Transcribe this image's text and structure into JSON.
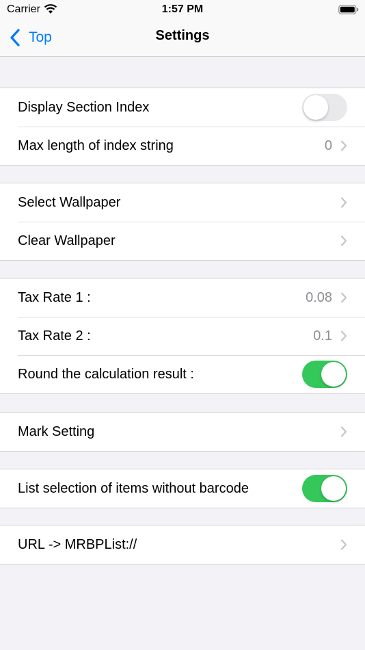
{
  "status": {
    "carrier": "Carrier",
    "time": "1:57 PM"
  },
  "nav": {
    "back_label": "Top",
    "title": "Settings"
  },
  "colors": {
    "accent": "#007aff",
    "toggle_on": "#34c759",
    "toggle_off": "#e9e9eb"
  },
  "sections": [
    {
      "rows": [
        {
          "label": "Display Section Index",
          "toggle": false
        },
        {
          "label": "Max length of index string",
          "detail": "0"
        }
      ]
    },
    {
      "rows": [
        {
          "label": "Select Wallpaper"
        },
        {
          "label": "Clear Wallpaper"
        }
      ]
    },
    {
      "rows": [
        {
          "label": "Tax Rate 1 :",
          "detail": "0.08"
        },
        {
          "label": "Tax Rate 2 :",
          "detail": "0.1"
        },
        {
          "label": "Round the calculation result :",
          "toggle": true
        }
      ]
    },
    {
      "rows": [
        {
          "label": "Mark Setting"
        }
      ]
    },
    {
      "rows": [
        {
          "label": "List selection of items without barcode",
          "toggle": true
        }
      ]
    },
    {
      "rows": [
        {
          "label": "URL -> MRBPList://"
        }
      ]
    }
  ]
}
